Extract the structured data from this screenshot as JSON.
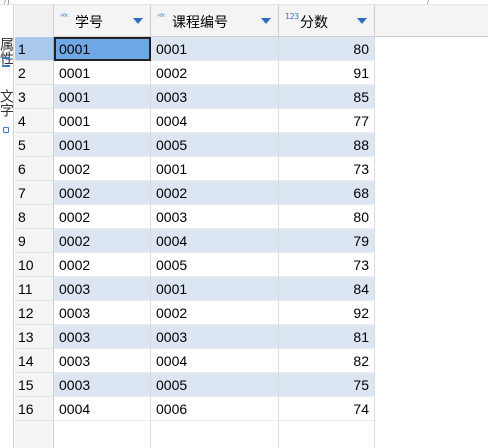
{
  "top_marks": [
    "/)",
    "/"
  ],
  "side_tabs": [
    "属性",
    "文字"
  ],
  "columns": [
    {
      "label": "学号",
      "type_icon": "ABC-text-icon",
      "type_text": "ᴬᴮᶜ",
      "sort": "descending"
    },
    {
      "label": "课程编号",
      "type_icon": "ABC-text-icon",
      "type_text": "ᴬᴮᶜ",
      "sort": "descending"
    },
    {
      "label": "分数",
      "type_icon": "numeric-123-icon",
      "type_text": "123",
      "sort": "descending"
    }
  ],
  "selected_row": 0,
  "colors": {
    "alt_row": "#dce6f3",
    "selected_cell": "#6fa8e5",
    "sort_arrow": "#2f6ec6",
    "type_icon": "#3b79c9"
  },
  "rows": [
    {
      "num": "1",
      "sid": "0001",
      "cid": "0001",
      "score": "80"
    },
    {
      "num": "2",
      "sid": "0001",
      "cid": "0002",
      "score": "91"
    },
    {
      "num": "3",
      "sid": "0001",
      "cid": "0003",
      "score": "85"
    },
    {
      "num": "4",
      "sid": "0001",
      "cid": "0004",
      "score": "77"
    },
    {
      "num": "5",
      "sid": "0001",
      "cid": "0005",
      "score": "88"
    },
    {
      "num": "6",
      "sid": "0002",
      "cid": "0001",
      "score": "73"
    },
    {
      "num": "7",
      "sid": "0002",
      "cid": "0002",
      "score": "68"
    },
    {
      "num": "8",
      "sid": "0002",
      "cid": "0003",
      "score": "80"
    },
    {
      "num": "9",
      "sid": "0002",
      "cid": "0004",
      "score": "79"
    },
    {
      "num": "10",
      "sid": "0002",
      "cid": "0005",
      "score": "73"
    },
    {
      "num": "11",
      "sid": "0003",
      "cid": "0001",
      "score": "84"
    },
    {
      "num": "12",
      "sid": "0003",
      "cid": "0002",
      "score": "92"
    },
    {
      "num": "13",
      "sid": "0003",
      "cid": "0003",
      "score": "81"
    },
    {
      "num": "14",
      "sid": "0003",
      "cid": "0004",
      "score": "82"
    },
    {
      "num": "15",
      "sid": "0003",
      "cid": "0005",
      "score": "75"
    },
    {
      "num": "16",
      "sid": "0004",
      "cid": "0006",
      "score": "74"
    }
  ]
}
